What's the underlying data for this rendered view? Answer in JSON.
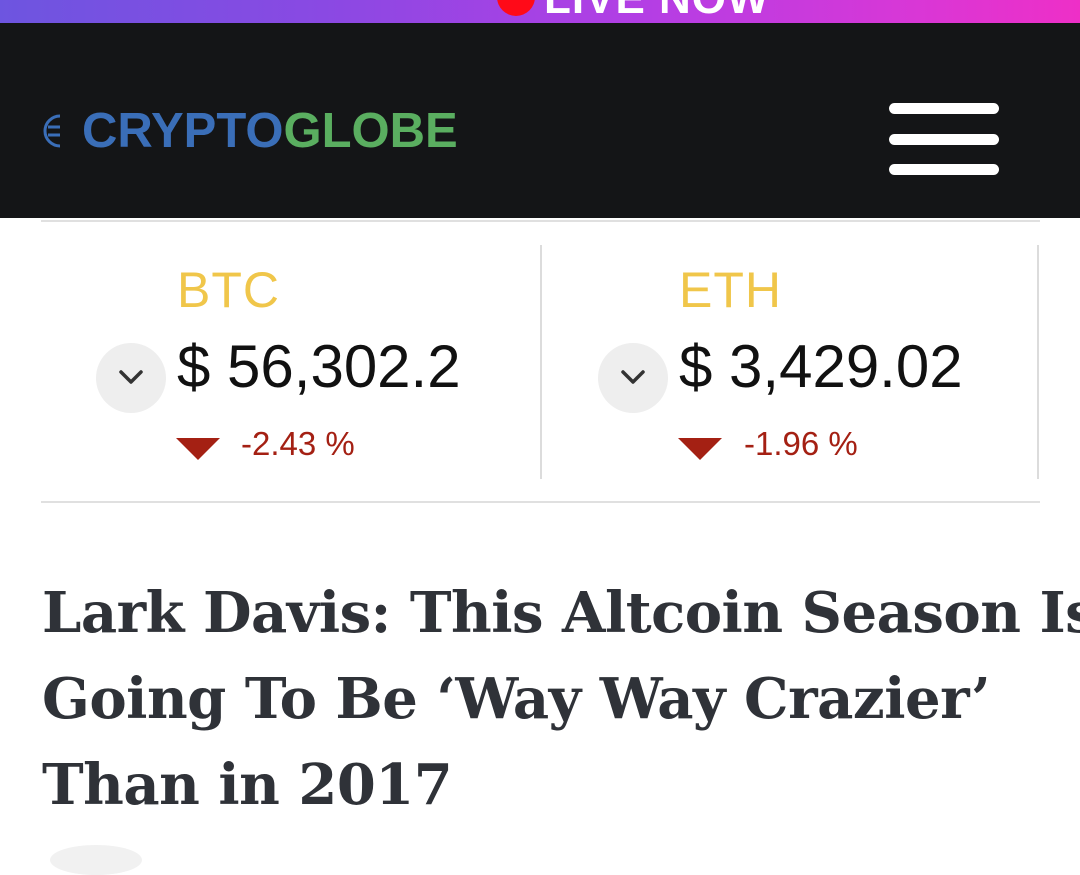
{
  "banner": {
    "text": "LIVE NOW"
  },
  "header": {
    "logo_part1": "CRYPTO",
    "logo_part2": "GLOBE",
    "menu_icon": "hamburger-menu-icon"
  },
  "ticker": {
    "coins": [
      {
        "symbol": "BTC",
        "price": "$ 56,302.2",
        "change": "-2.43 %",
        "direction": "down"
      },
      {
        "symbol": "ETH",
        "price": "$ 3,429.02",
        "change": "-1.96 %",
        "direction": "down"
      }
    ]
  },
  "article": {
    "title_lines": [
      "Lark Davis: This Altcoin Season Is",
      "Going To Be ‘Way Way Crazier’",
      "Than in 2017"
    ]
  },
  "colors": {
    "header_bg": "#141517",
    "logo_blue": "#3a6eb8",
    "logo_green": "#5aae60",
    "symbol_yellow": "#f0c64a",
    "negative_red": "#a42013"
  }
}
